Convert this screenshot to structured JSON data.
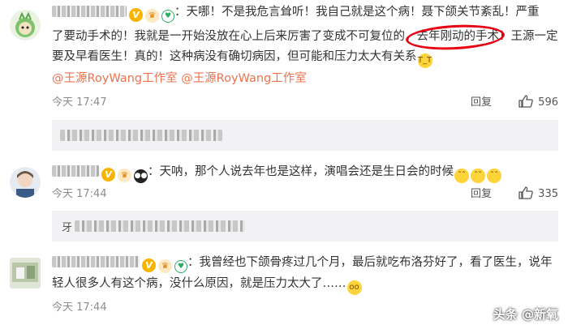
{
  "comments": [
    {
      "text_line1_tail": "：天哪！不是我危言耸听！我自己就是这个病！聂下颌关节紊乱！严重",
      "text_line2a": "了要动手术的！我就是一开始没放在心上后来厉害了变成不可复位的，",
      "text_line2_highlight": "去年刚动的手术！",
      "text_line2c": "王源一定",
      "text_line3": "要及早看医生！真的！这种病没有确切病因，但可能和压力太大有关系",
      "mention1": "@王源RoyWang工作室",
      "mention2": "@王源RoyWang工作室",
      "time": "今天 17:47",
      "reply": "回复",
      "likes": "596"
    },
    {
      "text": "：天呐，那个人说去年也是这样，演唱会还是生日会的时候",
      "time": "今天 17:44",
      "reply": "回复",
      "likes": "335"
    },
    {
      "text_line1": "：我曾经也下颌骨疼过几个月，最后就吃布洛芬好了，看了医生，说年",
      "text_line2": "轻人很多人有这个病，没什么原因，就是压力太大了……",
      "time": "今天 17:44",
      "reply": "回复",
      "likes": ""
    }
  ],
  "sub_prefix": "牙",
  "watermark": "头条 @新氧",
  "icons": {
    "thumb": "thumbs-up-icon",
    "verified": "verified-v-icon",
    "crown": "crown-badge-icon",
    "heart": "heart-badge-icon",
    "panda": "panda-icon"
  },
  "colors": {
    "mention": "#eb7350",
    "highlight_ring": "#e60012",
    "meta": "#8c8c8c"
  }
}
